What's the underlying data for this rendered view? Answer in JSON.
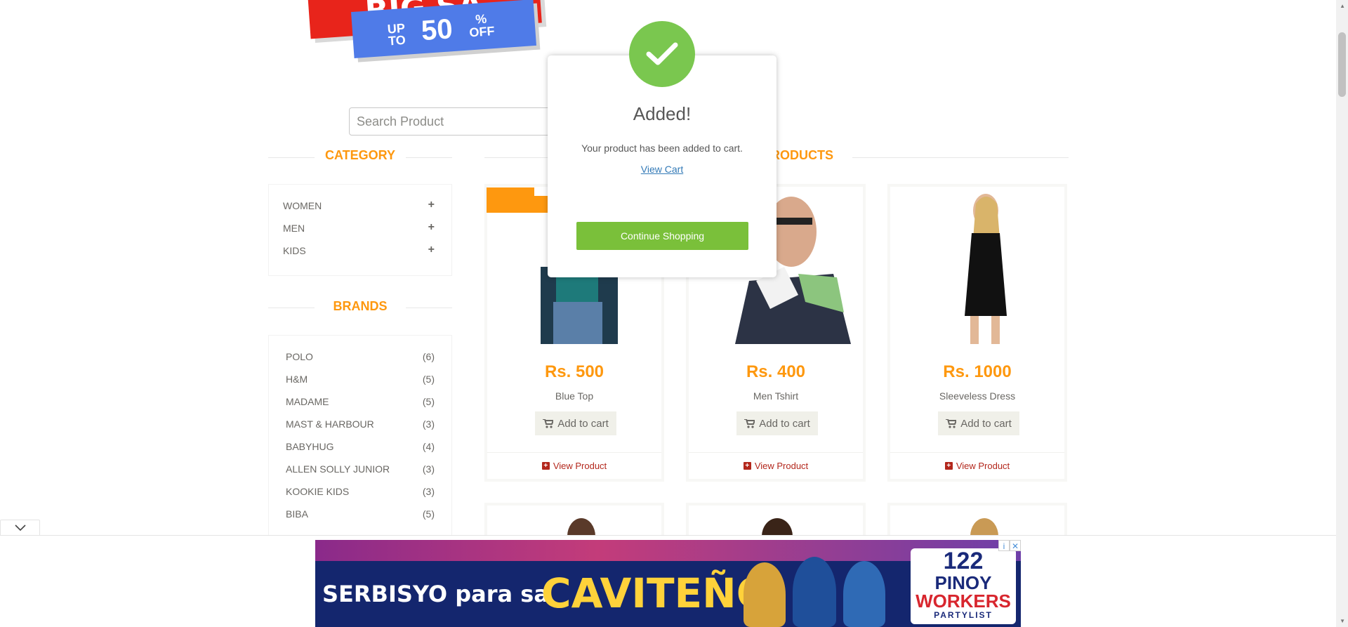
{
  "banner": {
    "big_sale": "BIG SA",
    "up_to": "UP TO",
    "percent": "50",
    "pct_off": "% OFF"
  },
  "search": {
    "placeholder": "Search Product"
  },
  "sidebar": {
    "category_title": "CATEGORY",
    "categories": [
      {
        "label": "WOMEN"
      },
      {
        "label": "MEN"
      },
      {
        "label": "KIDS"
      }
    ],
    "brands_title": "BRANDS",
    "brands": [
      {
        "label": "POLO",
        "count": "(6)"
      },
      {
        "label": "H&M",
        "count": "(5)"
      },
      {
        "label": "MADAME",
        "count": "(5)"
      },
      {
        "label": "MAST & HARBOUR",
        "count": "(3)"
      },
      {
        "label": "BABYHUG",
        "count": "(4)"
      },
      {
        "label": "ALLEN SOLLY JUNIOR",
        "count": "(3)"
      },
      {
        "label": "KOOKIE KIDS",
        "count": "(3)"
      },
      {
        "label": "BIBA",
        "count": "(5)"
      }
    ]
  },
  "main": {
    "section_title_visible": "PRODUCTS",
    "products": [
      {
        "price": "Rs. 500",
        "name": "Blue Top",
        "add_label": "Add to cart",
        "view_label": "View Product"
      },
      {
        "price": "Rs. 400",
        "name": "Men Tshirt",
        "add_label": "Add to cart",
        "view_label": "View Product"
      },
      {
        "price": "Rs. 1000",
        "name": "Sleeveless Dress",
        "add_label": "Add to cart",
        "view_label": "View Product"
      }
    ]
  },
  "modal": {
    "title": "Added!",
    "message": "Your product has been added to cart.",
    "link": "View Cart",
    "button": "Continue Shopping"
  },
  "ad": {
    "headline": "SERBISYO para sa",
    "highlight": "CAVITEÑO",
    "logo_number": "122",
    "logo_line1": "PINOY",
    "logo_line2": "WORKERS",
    "logo_line3": "PARTYLIST",
    "info_icon": "i",
    "close_icon": "✕"
  },
  "colors": {
    "accent": "#fe980f",
    "success": "#7ac74f",
    "button_green": "#7ac03a",
    "link": "#337ab7",
    "view_red": "#b3271c"
  }
}
